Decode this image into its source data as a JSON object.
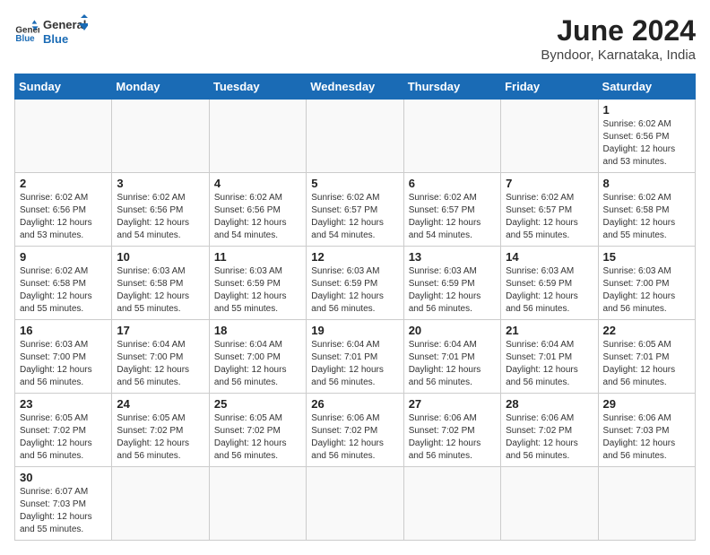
{
  "header": {
    "logo_general": "General",
    "logo_blue": "Blue",
    "title": "June 2024",
    "subtitle": "Byndoor, Karnataka, India"
  },
  "calendar": {
    "days_of_week": [
      "Sunday",
      "Monday",
      "Tuesday",
      "Wednesday",
      "Thursday",
      "Friday",
      "Saturday"
    ],
    "weeks": [
      [
        {
          "day": "",
          "info": ""
        },
        {
          "day": "",
          "info": ""
        },
        {
          "day": "",
          "info": ""
        },
        {
          "day": "",
          "info": ""
        },
        {
          "day": "",
          "info": ""
        },
        {
          "day": "",
          "info": ""
        },
        {
          "day": "1",
          "info": "Sunrise: 6:02 AM\nSunset: 6:56 PM\nDaylight: 12 hours\nand 53 minutes."
        }
      ],
      [
        {
          "day": "2",
          "info": "Sunrise: 6:02 AM\nSunset: 6:56 PM\nDaylight: 12 hours\nand 53 minutes."
        },
        {
          "day": "3",
          "info": "Sunrise: 6:02 AM\nSunset: 6:56 PM\nDaylight: 12 hours\nand 54 minutes."
        },
        {
          "day": "4",
          "info": "Sunrise: 6:02 AM\nSunset: 6:56 PM\nDaylight: 12 hours\nand 54 minutes."
        },
        {
          "day": "5",
          "info": "Sunrise: 6:02 AM\nSunset: 6:57 PM\nDaylight: 12 hours\nand 54 minutes."
        },
        {
          "day": "6",
          "info": "Sunrise: 6:02 AM\nSunset: 6:57 PM\nDaylight: 12 hours\nand 54 minutes."
        },
        {
          "day": "7",
          "info": "Sunrise: 6:02 AM\nSunset: 6:57 PM\nDaylight: 12 hours\nand 55 minutes."
        },
        {
          "day": "8",
          "info": "Sunrise: 6:02 AM\nSunset: 6:58 PM\nDaylight: 12 hours\nand 55 minutes."
        }
      ],
      [
        {
          "day": "9",
          "info": "Sunrise: 6:02 AM\nSunset: 6:58 PM\nDaylight: 12 hours\nand 55 minutes."
        },
        {
          "day": "10",
          "info": "Sunrise: 6:03 AM\nSunset: 6:58 PM\nDaylight: 12 hours\nand 55 minutes."
        },
        {
          "day": "11",
          "info": "Sunrise: 6:03 AM\nSunset: 6:59 PM\nDaylight: 12 hours\nand 55 minutes."
        },
        {
          "day": "12",
          "info": "Sunrise: 6:03 AM\nSunset: 6:59 PM\nDaylight: 12 hours\nand 56 minutes."
        },
        {
          "day": "13",
          "info": "Sunrise: 6:03 AM\nSunset: 6:59 PM\nDaylight: 12 hours\nand 56 minutes."
        },
        {
          "day": "14",
          "info": "Sunrise: 6:03 AM\nSunset: 6:59 PM\nDaylight: 12 hours\nand 56 minutes."
        },
        {
          "day": "15",
          "info": "Sunrise: 6:03 AM\nSunset: 7:00 PM\nDaylight: 12 hours\nand 56 minutes."
        }
      ],
      [
        {
          "day": "16",
          "info": "Sunrise: 6:03 AM\nSunset: 7:00 PM\nDaylight: 12 hours\nand 56 minutes."
        },
        {
          "day": "17",
          "info": "Sunrise: 6:04 AM\nSunset: 7:00 PM\nDaylight: 12 hours\nand 56 minutes."
        },
        {
          "day": "18",
          "info": "Sunrise: 6:04 AM\nSunset: 7:00 PM\nDaylight: 12 hours\nand 56 minutes."
        },
        {
          "day": "19",
          "info": "Sunrise: 6:04 AM\nSunset: 7:01 PM\nDaylight: 12 hours\nand 56 minutes."
        },
        {
          "day": "20",
          "info": "Sunrise: 6:04 AM\nSunset: 7:01 PM\nDaylight: 12 hours\nand 56 minutes."
        },
        {
          "day": "21",
          "info": "Sunrise: 6:04 AM\nSunset: 7:01 PM\nDaylight: 12 hours\nand 56 minutes."
        },
        {
          "day": "22",
          "info": "Sunrise: 6:05 AM\nSunset: 7:01 PM\nDaylight: 12 hours\nand 56 minutes."
        }
      ],
      [
        {
          "day": "23",
          "info": "Sunrise: 6:05 AM\nSunset: 7:02 PM\nDaylight: 12 hours\nand 56 minutes."
        },
        {
          "day": "24",
          "info": "Sunrise: 6:05 AM\nSunset: 7:02 PM\nDaylight: 12 hours\nand 56 minutes."
        },
        {
          "day": "25",
          "info": "Sunrise: 6:05 AM\nSunset: 7:02 PM\nDaylight: 12 hours\nand 56 minutes."
        },
        {
          "day": "26",
          "info": "Sunrise: 6:06 AM\nSunset: 7:02 PM\nDaylight: 12 hours\nand 56 minutes."
        },
        {
          "day": "27",
          "info": "Sunrise: 6:06 AM\nSunset: 7:02 PM\nDaylight: 12 hours\nand 56 minutes."
        },
        {
          "day": "28",
          "info": "Sunrise: 6:06 AM\nSunset: 7:02 PM\nDaylight: 12 hours\nand 56 minutes."
        },
        {
          "day": "29",
          "info": "Sunrise: 6:06 AM\nSunset: 7:03 PM\nDaylight: 12 hours\nand 56 minutes."
        }
      ],
      [
        {
          "day": "30",
          "info": "Sunrise: 6:07 AM\nSunset: 7:03 PM\nDaylight: 12 hours\nand 55 minutes."
        },
        {
          "day": "",
          "info": ""
        },
        {
          "day": "",
          "info": ""
        },
        {
          "day": "",
          "info": ""
        },
        {
          "day": "",
          "info": ""
        },
        {
          "day": "",
          "info": ""
        },
        {
          "day": "",
          "info": ""
        }
      ]
    ]
  }
}
